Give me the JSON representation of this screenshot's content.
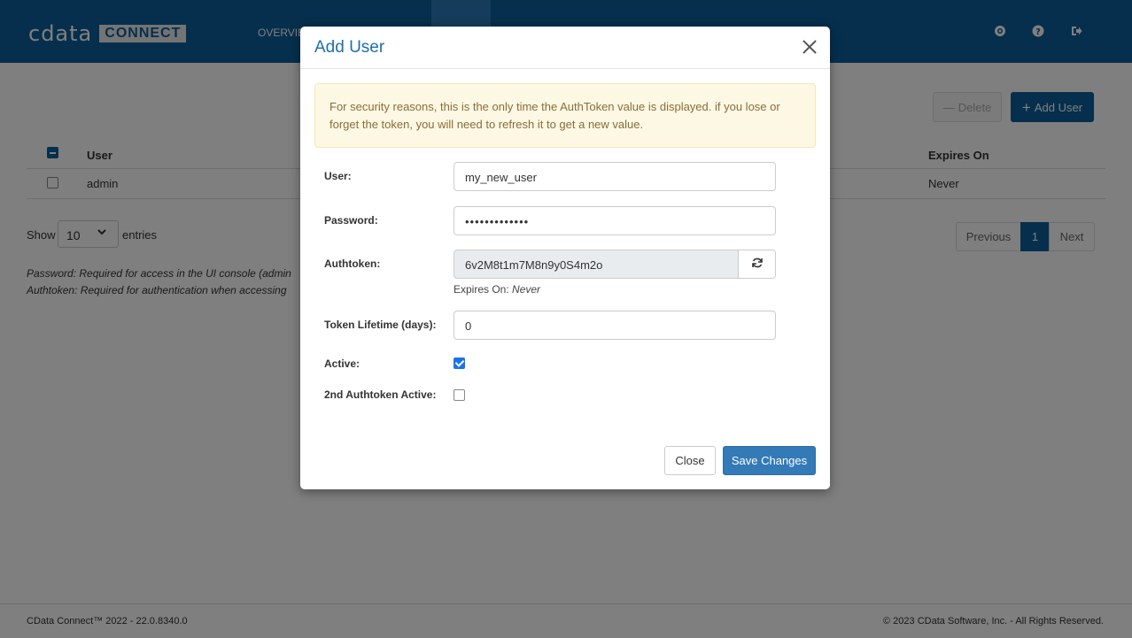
{
  "header": {
    "logo_text": "cdata",
    "logo_badge": "CONNECT",
    "nav": {
      "overview": "OVERVIE"
    },
    "icons": [
      "gear-icon",
      "help-icon",
      "logout-icon"
    ]
  },
  "toolbar": {
    "delete_label": "Delete",
    "add_user_label": "Add User"
  },
  "table": {
    "headers": {
      "user": "User",
      "expires_on": "Expires On"
    },
    "rows": [
      {
        "user": "admin",
        "expires_on": "Never"
      }
    ]
  },
  "length_menu": {
    "show": "Show",
    "value": "10",
    "entries": "entries"
  },
  "pager": {
    "previous": "Previous",
    "current": "1",
    "next": "Next"
  },
  "notes": {
    "password": "Password: Required for access in the UI console (admin",
    "authtoken": "Authtoken: Required for authentication when accessing"
  },
  "footer": {
    "version": "CData Connect™ 2022 - 22.0.8340.0",
    "copyright": "© 2023 CData Software, Inc. - All Rights Reserved."
  },
  "modal": {
    "title": "Add User",
    "alert": "For security reasons, this is the only time the AuthToken value is displayed. if you lose or forget the token, you will need to refresh it to get a new value.",
    "user_label": "User:",
    "user_value": "my_new_user",
    "password_label": "Password:",
    "password_value": "•••••••••••••",
    "authtoken_label": "Authtoken:",
    "authtoken_value": "6v2M8t1m7M8n9y0S4m2o",
    "expires_prefix": "Expires On: ",
    "expires_value": "Never",
    "lifetime_label": "Token Lifetime (days):",
    "lifetime_value": "0",
    "active_label": "Active:",
    "active_checked": true,
    "second_token_label": "2nd Authtoken Active:",
    "second_token_checked": false,
    "close_label": "Close",
    "save_label": "Save Changes"
  },
  "colors": {
    "brand": "#0b5e9a",
    "primary_button": "#337ab7",
    "modal_title": "#1d6fad",
    "alert_bg": "#fcf8e3",
    "alert_text": "#8a6d3b"
  }
}
